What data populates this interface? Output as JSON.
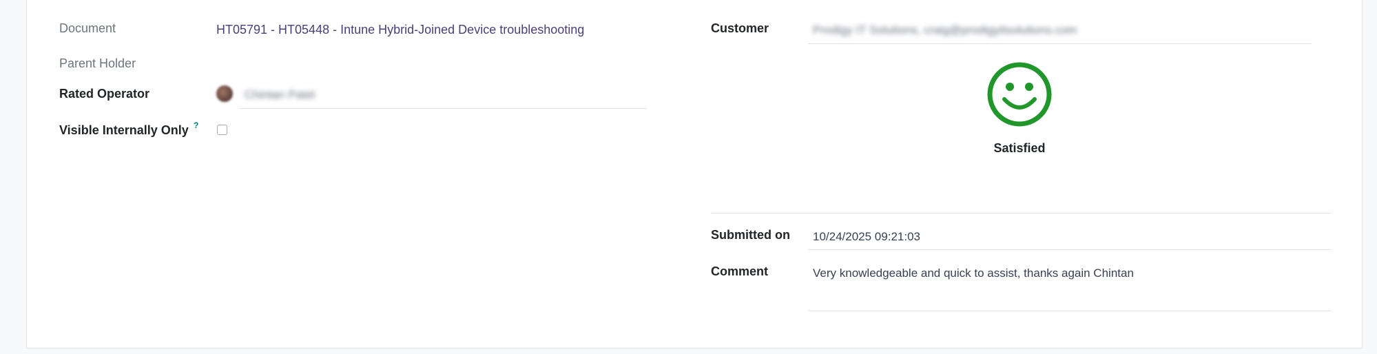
{
  "left": {
    "document_label": "Document",
    "document_value": "HT05791 - HT05448 - Intune Hybrid-Joined Device troubleshooting",
    "parent_holder_label": "Parent Holder",
    "rated_operator_label": "Rated Operator",
    "rated_operator_value": "Chintan Patel",
    "visible_internally_label": "Visible Internally Only",
    "visible_internally_help": "?",
    "visible_internally_checked": false
  },
  "right": {
    "customer_label": "Customer",
    "customer_value": "Prodigy IT Solutions, craig@prodigyitsolutions.com",
    "rating_label": "Satisfied",
    "rating_icon": "smiley-face-icon",
    "rating_color": "#21962b",
    "submitted_label": "Submitted on",
    "submitted_value": "10/24/2025 09:21:03",
    "comment_label": "Comment",
    "comment_value": "Very knowledgeable and quick to assist, thanks again Chintan"
  }
}
